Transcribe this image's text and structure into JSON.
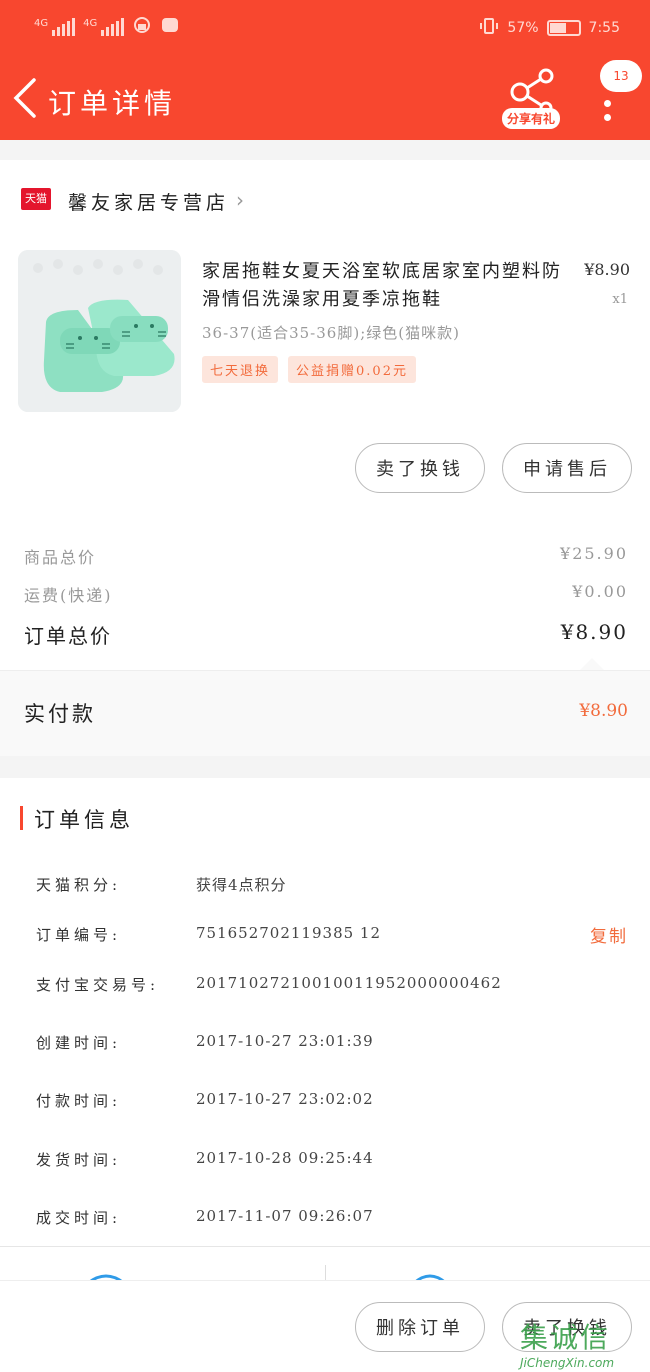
{
  "status_bar": {
    "network_1": "4G",
    "network_2": "4G",
    "battery": "57%",
    "time": "7:55"
  },
  "header": {
    "title": "订单详情",
    "share_label": "分享有礼",
    "message_count": "13"
  },
  "store": {
    "badge": "天猫",
    "name": "馨友家居专营店"
  },
  "product": {
    "name": "家居拖鞋女夏天浴室软底居家室内塑料防滑情侣洗澡家用夏季凉拖鞋",
    "price": "¥8.90",
    "quantity": "x1",
    "sku": "36-37(适合35-36脚);绿色(猫咪款)",
    "tags": [
      "七天退换",
      "公益捐赠0.02元"
    ],
    "buttons": [
      "卖了换钱",
      "申请售后"
    ]
  },
  "summary": [
    {
      "label": "商品总价",
      "value": "¥25.90"
    },
    {
      "label": "运费(快递)",
      "value": "¥0.00"
    },
    {
      "label": "订单总价",
      "value": "¥8.90"
    }
  ],
  "paid": {
    "label": "实付款",
    "value": "¥8.90"
  },
  "order_info": {
    "title": "订单信息",
    "rows": [
      {
        "key": "天猫积分:",
        "value": "获得4点积分"
      },
      {
        "key": "订单编号:",
        "value": "751652702119385 12",
        "action": "复制"
      },
      {
        "key": "支付宝交易号:",
        "value": "20171027210010011952000000462"
      },
      {
        "key": "创建时间:",
        "value": "2017-10-27 23:01:39"
      },
      {
        "key": "付款时间:",
        "value": "2017-10-27 23:02:02"
      },
      {
        "key": "发货时间:",
        "value": "2017-10-28 09:25:44"
      },
      {
        "key": "成交时间:",
        "value": "2017-11-07 09:26:07"
      }
    ]
  },
  "bottom_bar": {
    "buttons": [
      "删除订单",
      "卖了换钱"
    ]
  },
  "watermark": {
    "text": "集诚信",
    "url": "JiChengXin.com"
  },
  "colors": {
    "brand": "#f8472f",
    "accent": "#f26b3c",
    "tmall": "#e4152d"
  }
}
